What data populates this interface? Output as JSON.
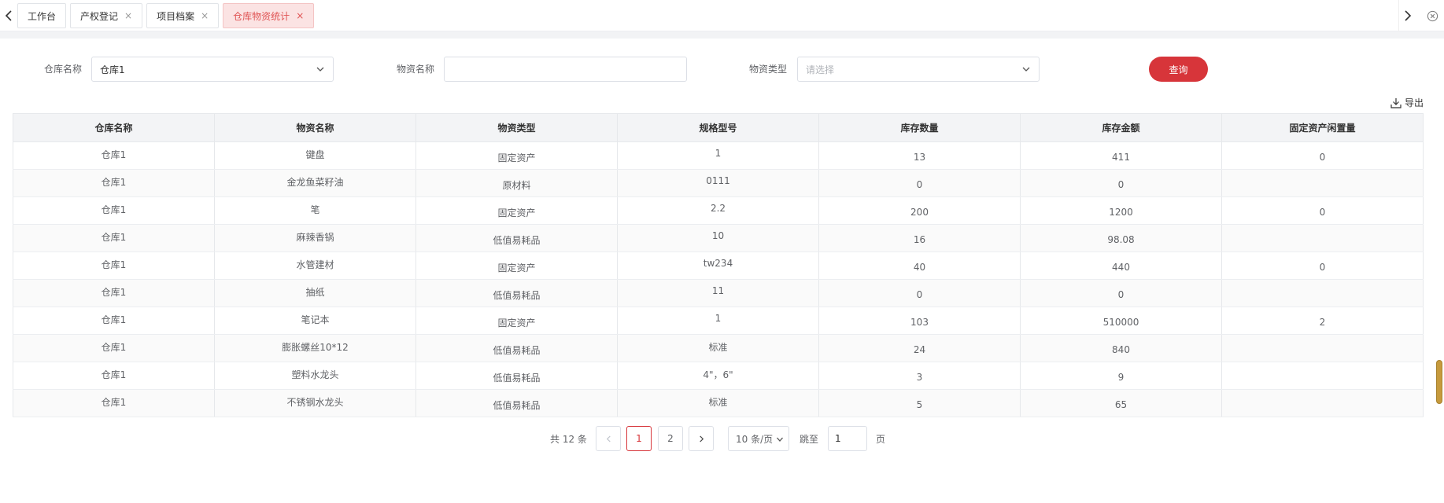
{
  "tabbar": {
    "tabs": [
      {
        "label": "工作台",
        "closable": false,
        "active": false
      },
      {
        "label": "产权登记",
        "closable": true,
        "active": false
      },
      {
        "label": "项目档案",
        "closable": true,
        "active": false
      },
      {
        "label": "仓库物资统计",
        "closable": true,
        "active": true
      }
    ],
    "close_glyph": "×"
  },
  "filter": {
    "warehouse_label": "仓库名称",
    "warehouse_value": "仓库1",
    "material_label": "物资名称",
    "material_value": "",
    "type_label": "物资类型",
    "type_placeholder": "请选择",
    "query_label": "查询"
  },
  "export_label": "导出",
  "table": {
    "columns": [
      "仓库名称",
      "物资名称",
      "物资类型",
      "规格型号",
      "库存数量",
      "库存金额",
      "固定资产闲置量"
    ],
    "rows": [
      [
        "仓库1",
        "键盘",
        "固定资产",
        "1",
        "13",
        "411",
        "0"
      ],
      [
        "仓库1",
        "金龙鱼菜籽油",
        "原材料",
        "0111",
        "0",
        "0",
        ""
      ],
      [
        "仓库1",
        "笔",
        "固定资产",
        "2.2",
        "200",
        "1200",
        "0"
      ],
      [
        "仓库1",
        "麻辣香锅",
        "低值易耗品",
        "10",
        "16",
        "98.08",
        ""
      ],
      [
        "仓库1",
        "水管建材",
        "固定资产",
        "tw234",
        "40",
        "440",
        "0"
      ],
      [
        "仓库1",
        "抽纸",
        "低值易耗品",
        "11",
        "0",
        "0",
        ""
      ],
      [
        "仓库1",
        "笔记本",
        "固定资产",
        "1",
        "103",
        "510000",
        "2"
      ],
      [
        "仓库1",
        "膨胀螺丝10*12",
        "低值易耗品",
        "标准",
        "24",
        "840",
        ""
      ],
      [
        "仓库1",
        "塑料水龙头",
        "低值易耗品",
        "4\"，6\"",
        "3",
        "9",
        ""
      ],
      [
        "仓库1",
        "不锈钢水龙头",
        "低值易耗品",
        "标准",
        "5",
        "65",
        ""
      ]
    ]
  },
  "pagination": {
    "total_text": "共 12 条",
    "pages": [
      "1",
      "2"
    ],
    "current_page": "1",
    "page_size": "10 条/页",
    "jump_label": "跳至",
    "jump_value": "1",
    "page_suffix": "页"
  },
  "colors": {
    "accent": "#d7353a",
    "active_tab_bg": "#fbe3e3",
    "header_bg": "#f3f4f6"
  }
}
